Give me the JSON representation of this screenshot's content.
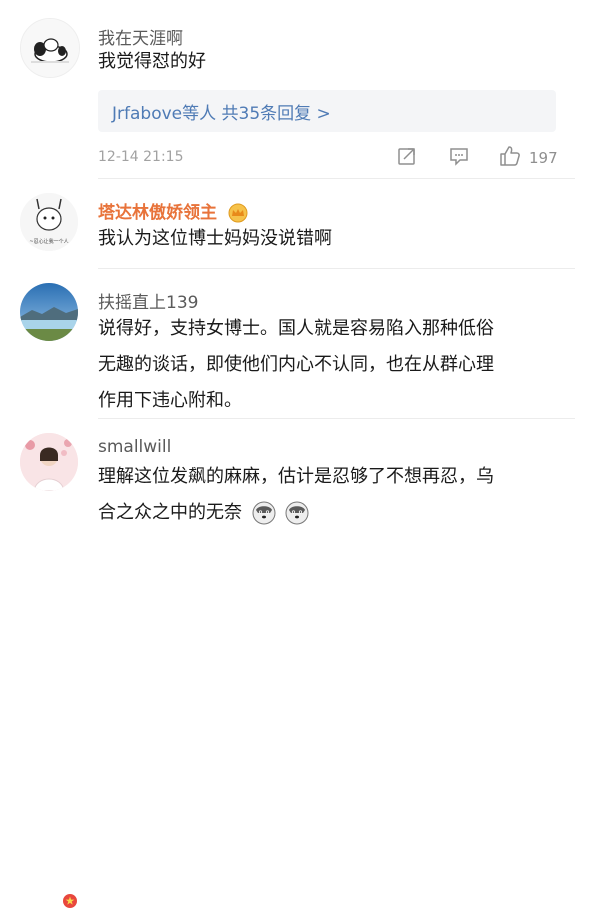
{
  "comments": [
    {
      "username": "我在天涯啊",
      "text": "我觉得怼的好",
      "replies_summary": "Jrfabove等人  共35条回复 >",
      "timestamp": "12-14 21:15",
      "like_count": "197",
      "icons": [
        "share-icon",
        "comment-icon",
        "like-icon"
      ]
    },
    {
      "username": "塔达林傲娇领主",
      "username_color": "#e8733a",
      "avatar_caption": "~忍心让我一个人",
      "text": "我认为这位博士妈妈没说错啊"
    },
    {
      "username": "扶摇直上139",
      "text_lines": [
        "说得好，支持女博士。国人就是容易陷入那种低俗",
        "无趣的谈话，即使他们内心不认同，也在从群心理",
        "作用下违心附和。"
      ]
    },
    {
      "username": "smallwill",
      "text_lines": [
        "理解这位发飙的麻麻，估计是忍够了不想再忍，乌",
        "合之众之中的无奈"
      ]
    }
  ]
}
